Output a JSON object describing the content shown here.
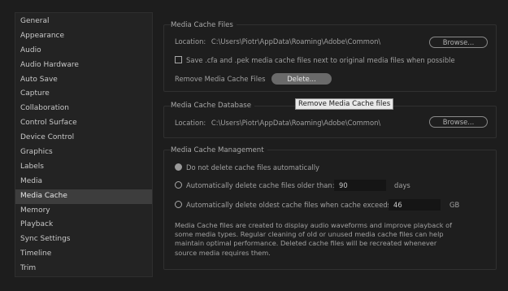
{
  "sidebar": {
    "items": [
      {
        "label": "General"
      },
      {
        "label": "Appearance"
      },
      {
        "label": "Audio"
      },
      {
        "label": "Audio Hardware"
      },
      {
        "label": "Auto Save"
      },
      {
        "label": "Capture"
      },
      {
        "label": "Collaboration"
      },
      {
        "label": "Control Surface"
      },
      {
        "label": "Device Control"
      },
      {
        "label": "Graphics"
      },
      {
        "label": "Labels"
      },
      {
        "label": "Media"
      },
      {
        "label": "Media Cache"
      },
      {
        "label": "Memory"
      },
      {
        "label": "Playback"
      },
      {
        "label": "Sync Settings"
      },
      {
        "label": "Timeline"
      },
      {
        "label": "Trim"
      }
    ],
    "selected": "Media Cache"
  },
  "cache_files": {
    "title": "Media Cache Files",
    "location_label": "Location:",
    "location_value": "C:\\Users\\Piotr\\AppData\\Roaming\\Adobe\\Common\\",
    "browse_label": "Browse...",
    "save_next_label": "Save .cfa and .pek media cache files next to original media files when possible",
    "remove_label": "Remove Media Cache Files",
    "delete_label": "Delete..."
  },
  "tooltip": {
    "text": "Remove Media Cache files"
  },
  "cache_database": {
    "title": "Media Cache Database",
    "location_label": "Location:",
    "location_value": "C:\\Users\\Piotr\\AppData\\Roaming\\Adobe\\Common\\",
    "browse_label": "Browse..."
  },
  "cache_management": {
    "title": "Media Cache Management",
    "option_no_delete": "Do not delete cache files automatically",
    "option_older_than": "Automatically delete cache files older than:",
    "older_than_value": "90",
    "older_than_unit": "days",
    "option_exceeds": "Automatically delete oldest cache files when cache exceeds:",
    "exceeds_value": "46",
    "exceeds_unit": "GB",
    "description": "Media Cache files are created to display audio waveforms and improve playback of some media types.  Regular cleaning of old or unused media cache files can help maintain optimal performance. Deleted cache files will be recreated whenever source media requires them."
  }
}
